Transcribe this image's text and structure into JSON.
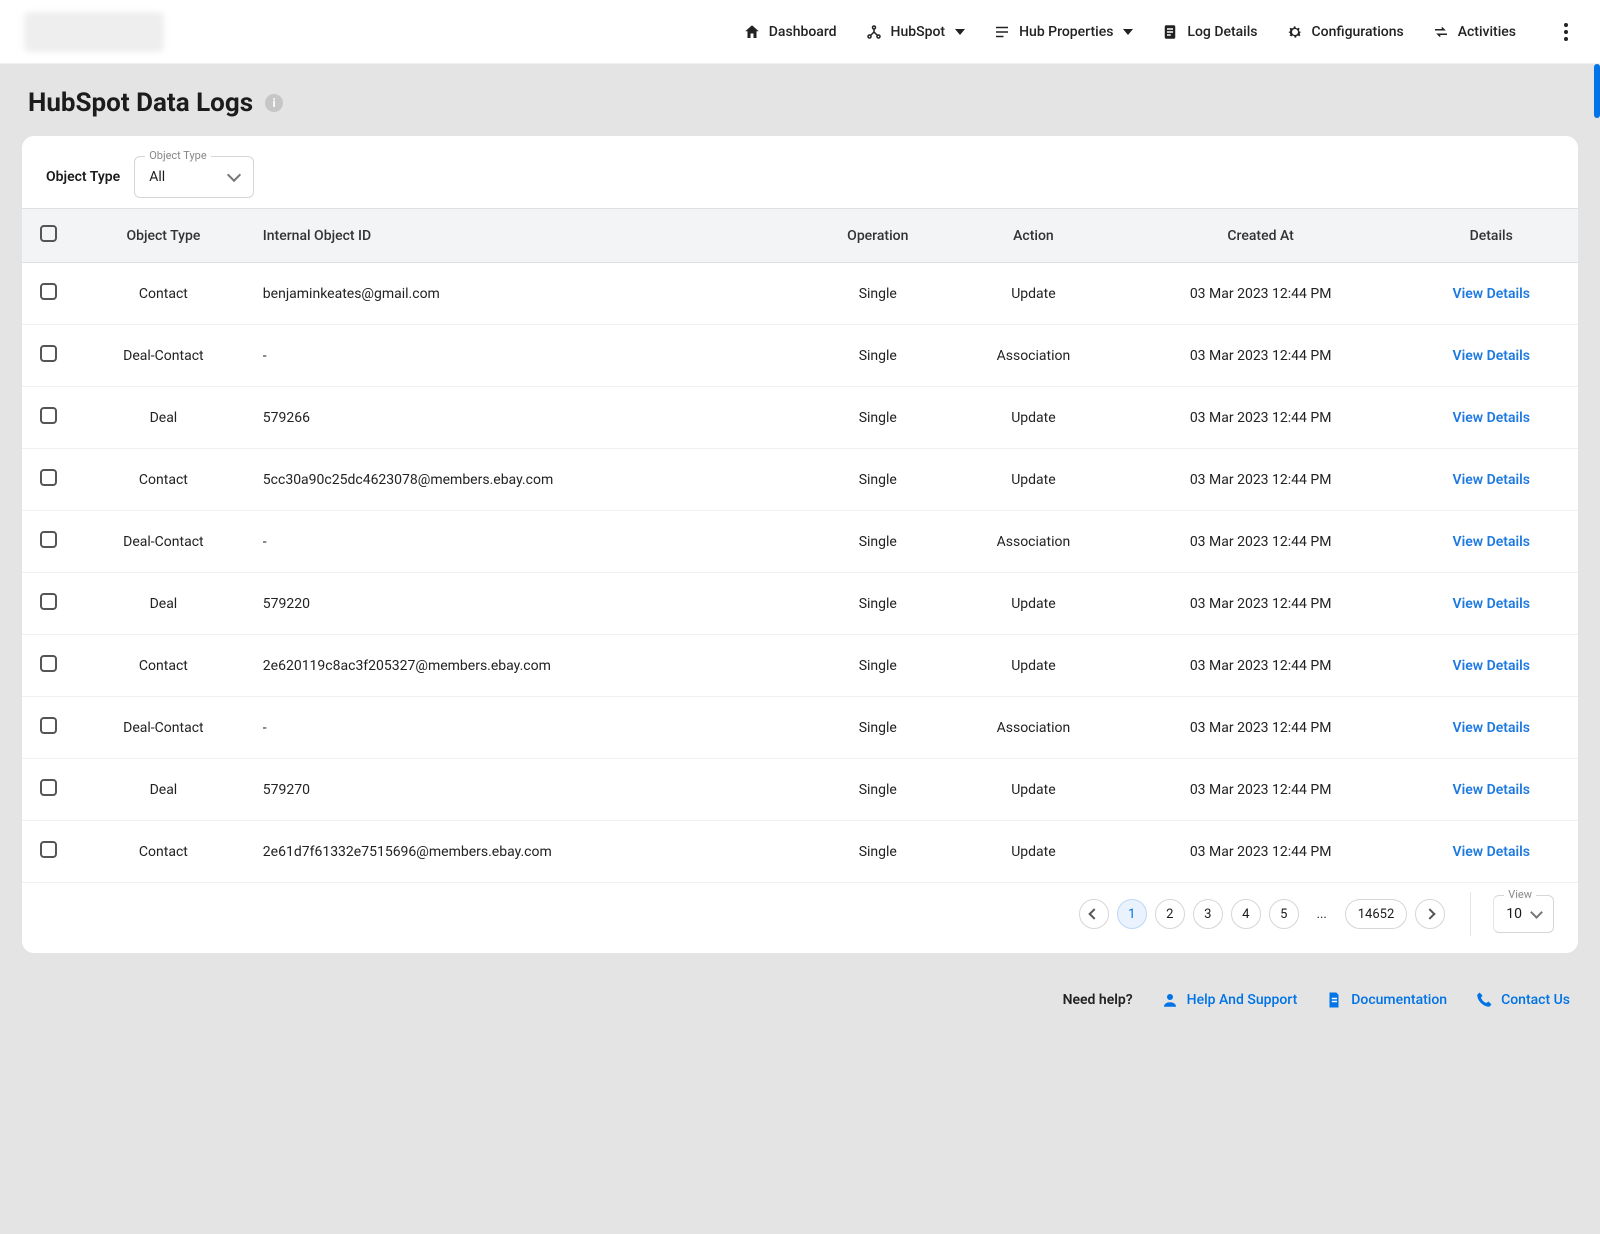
{
  "nav": {
    "dashboard": "Dashboard",
    "hubspot": "HubSpot",
    "hub_properties": "Hub Properties",
    "log_details": "Log Details",
    "configurations": "Configurations",
    "activities": "Activities"
  },
  "page": {
    "title": "HubSpot Data Logs"
  },
  "filter": {
    "label": "Object Type",
    "floating": "Object Type",
    "value": "All"
  },
  "table": {
    "headers": {
      "object_type": "Object Type",
      "internal_id": "Internal Object ID",
      "operation": "Operation",
      "action": "Action",
      "created_at": "Created At",
      "details": "Details"
    },
    "view_details": "View Details",
    "rows": [
      {
        "object_type": "Contact",
        "internal_id": "benjaminkeates@gmail.com",
        "operation": "Single",
        "action": "Update",
        "created_at": "03 Mar 2023 12:44 PM"
      },
      {
        "object_type": "Deal-Contact",
        "internal_id": "-",
        "operation": "Single",
        "action": "Association",
        "created_at": "03 Mar 2023 12:44 PM"
      },
      {
        "object_type": "Deal",
        "internal_id": "579266",
        "operation": "Single",
        "action": "Update",
        "created_at": "03 Mar 2023 12:44 PM"
      },
      {
        "object_type": "Contact",
        "internal_id": "5cc30a90c25dc4623078@members.ebay.com",
        "operation": "Single",
        "action": "Update",
        "created_at": "03 Mar 2023 12:44 PM"
      },
      {
        "object_type": "Deal-Contact",
        "internal_id": "-",
        "operation": "Single",
        "action": "Association",
        "created_at": "03 Mar 2023 12:44 PM"
      },
      {
        "object_type": "Deal",
        "internal_id": "579220",
        "operation": "Single",
        "action": "Update",
        "created_at": "03 Mar 2023 12:44 PM"
      },
      {
        "object_type": "Contact",
        "internal_id": "2e620119c8ac3f205327@members.ebay.com",
        "operation": "Single",
        "action": "Update",
        "created_at": "03 Mar 2023 12:44 PM"
      },
      {
        "object_type": "Deal-Contact",
        "internal_id": "-",
        "operation": "Single",
        "action": "Association",
        "created_at": "03 Mar 2023 12:44 PM"
      },
      {
        "object_type": "Deal",
        "internal_id": "579270",
        "operation": "Single",
        "action": "Update",
        "created_at": "03 Mar 2023 12:44 PM"
      },
      {
        "object_type": "Contact",
        "internal_id": "2e61d7f61332e7515696@members.ebay.com",
        "operation": "Single",
        "action": "Update",
        "created_at": "03 Mar 2023 12:44 PM"
      }
    ]
  },
  "pagination": {
    "pages": [
      "1",
      "2",
      "3",
      "4",
      "5"
    ],
    "ellipsis": "...",
    "last": "14652",
    "active": "1",
    "view_label": "View",
    "view_value": "10"
  },
  "help": {
    "need": "Need help?",
    "support": "Help And Support",
    "docs": "Documentation",
    "contact": "Contact Us"
  }
}
